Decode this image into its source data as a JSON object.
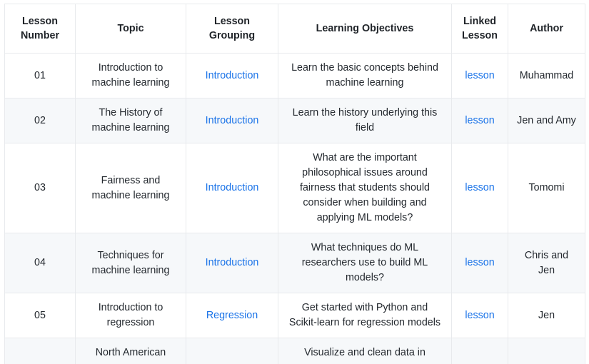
{
  "table": {
    "name": "lesson-curriculum-table",
    "columns": [
      {
        "key": "lesson_number",
        "label": "Lesson\nNumber"
      },
      {
        "key": "topic",
        "label": "Topic"
      },
      {
        "key": "lesson_grouping",
        "label": "Lesson\nGrouping"
      },
      {
        "key": "learning_objectives",
        "label": "Learning Objectives"
      },
      {
        "key": "linked_lesson",
        "label": "Linked\nLesson"
      },
      {
        "key": "author",
        "label": "Author"
      }
    ],
    "headers": {
      "lesson_number": "Lesson Number",
      "lesson_number_line1": "Lesson",
      "lesson_number_line2": "Number",
      "topic": "Topic",
      "lesson_grouping_line1": "Lesson",
      "lesson_grouping_line2": "Grouping",
      "learning_objectives": "Learning Objectives",
      "linked_lesson_line1": "Linked",
      "linked_lesson_line2": "Lesson",
      "author": "Author"
    },
    "rows": [
      {
        "lesson_number": "01",
        "topic": "Introduction to machine learning",
        "lesson_grouping": "Introduction",
        "learning_objectives": "Learn the basic concepts behind machine learning",
        "linked_lesson": "lesson",
        "author": "Muhammad"
      },
      {
        "lesson_number": "02",
        "topic": "The History of machine learning",
        "lesson_grouping": "Introduction",
        "learning_objectives": "Learn the history underlying this field",
        "linked_lesson": "lesson",
        "author": "Jen and Amy"
      },
      {
        "lesson_number": "03",
        "topic": "Fairness and machine learning",
        "lesson_grouping": "Introduction",
        "learning_objectives": "What are the important philosophical issues around fairness that students should consider when building and applying ML models?",
        "linked_lesson": "lesson",
        "author": "Tomomi"
      },
      {
        "lesson_number": "04",
        "topic": "Techniques for machine learning",
        "lesson_grouping": "Introduction",
        "learning_objectives": "What techniques do ML researchers use to build ML models?",
        "linked_lesson": "lesson",
        "author": "Chris and Jen"
      },
      {
        "lesson_number": "05",
        "topic": "Introduction to regression",
        "lesson_grouping": "Regression",
        "learning_objectives": "Get started with Python and Scikit-learn for regression models",
        "linked_lesson": "lesson",
        "author": "Jen"
      },
      {
        "lesson_number": "",
        "topic": "North American",
        "lesson_grouping": "",
        "learning_objectives": "Visualize and clean data in",
        "linked_lesson": "",
        "author": ""
      }
    ]
  },
  "colors": {
    "link": "#1a73e8",
    "text": "#24292f",
    "border": "#e8eaed",
    "row_alt_bg": "#f6f8fa",
    "row_bg": "#ffffff"
  }
}
